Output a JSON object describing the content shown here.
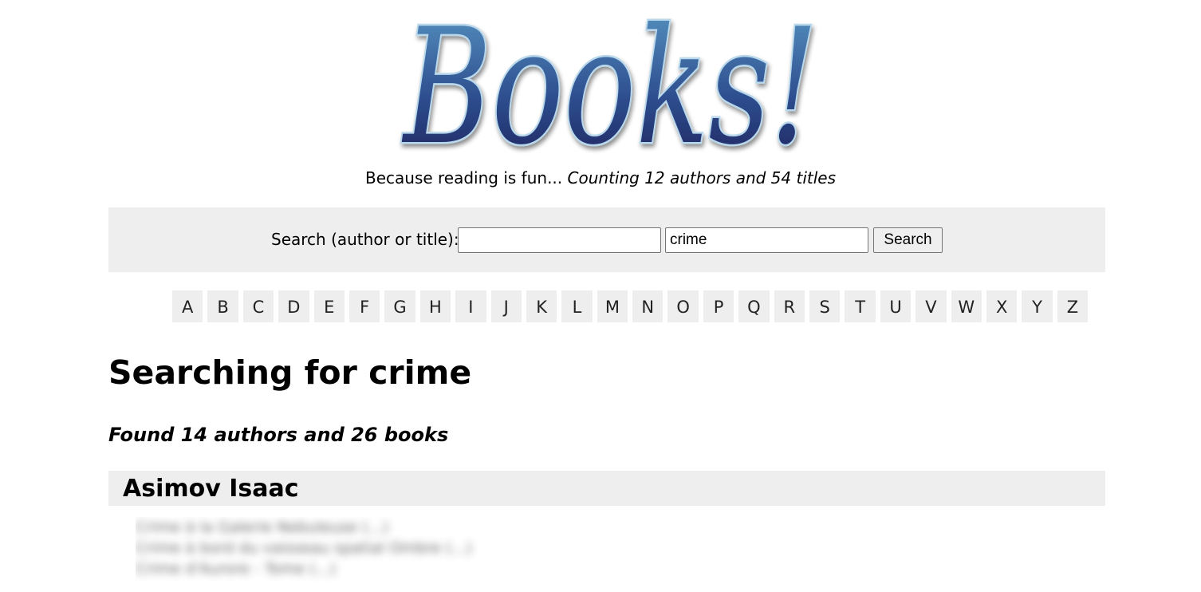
{
  "logo": {
    "text": "Books!",
    "colors": {
      "top": "#4d87b6",
      "bottom": "#1f1d5c",
      "outline": "#b9d8ec"
    }
  },
  "tagline": {
    "intro": "Because reading is fun...",
    "count": "Counting 12 authors and 54 titles"
  },
  "search": {
    "label": "Search (author or title):",
    "field_1_value": "",
    "field_2_value": "crime",
    "button_label": "Search"
  },
  "alphabet": [
    "A",
    "B",
    "C",
    "D",
    "E",
    "F",
    "G",
    "H",
    "I",
    "J",
    "K",
    "L",
    "M",
    "N",
    "O",
    "P",
    "Q",
    "R",
    "S",
    "T",
    "U",
    "V",
    "W",
    "X",
    "Y",
    "Z"
  ],
  "results": {
    "heading": "Searching for crime",
    "summary": "Found 14 authors and 26 books"
  },
  "author_group": {
    "name": "Asimov Isaac",
    "books": [
      "Crime à la Galerie Nebuleuse (...)",
      "Crime à bord du vaisseau spatial Ombre (...)",
      "Crime d'Aurore - Tome (...)"
    ]
  },
  "colors": {
    "panel_bg": "#eeeeee",
    "page_bg": "#ffffff"
  }
}
